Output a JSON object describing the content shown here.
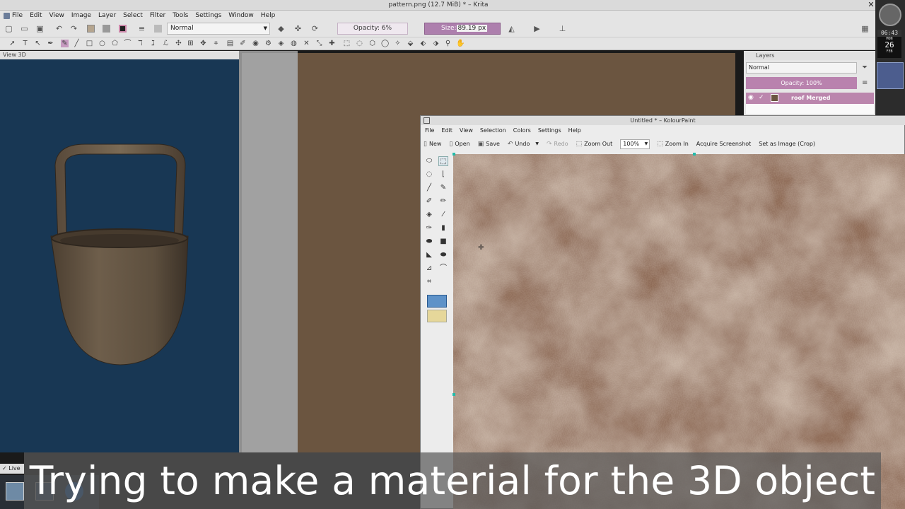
{
  "krita": {
    "title": "pattern.png (12.7 MiB) * – Krita",
    "menu": [
      "File",
      "Edit",
      "View",
      "Image",
      "Layer",
      "Select",
      "Filter",
      "Tools",
      "Settings",
      "Window",
      "Help"
    ],
    "blend_mode": "Normal",
    "opacity": "Opacity: 6%",
    "size_label": "Size:",
    "size_value": "89.19 px",
    "view3d_title": "View 3D",
    "layers": {
      "title": "Layers",
      "mode": "Normal",
      "opacity": "Opacity:  100%",
      "layer_name": "roof Merged"
    },
    "live_label": "Live"
  },
  "clock": {
    "time": "06:43",
    "day": "MON",
    "date": "26",
    "month": "FEB"
  },
  "kolourpaint": {
    "title": "Untitled * – KolourPaint",
    "menu": [
      "File",
      "Edit",
      "View",
      "Selection",
      "Colors",
      "Settings",
      "Help"
    ],
    "toolbar": {
      "new": "New",
      "open": "Open",
      "save": "Save",
      "undo": "Undo",
      "redo": "Redo",
      "zoom_out": "Zoom Out",
      "zoom_value": "100%",
      "zoom_in": "Zoom In",
      "acquire": "Acquire Screenshot",
      "set_image": "Set as Image (Crop)"
    }
  },
  "caption": "Trying to make a material for the 3D object",
  "colors": {
    "canvas_brown": "#6b5540",
    "view3d_bg": "#183754",
    "accent_purple": "#ad7fad"
  }
}
